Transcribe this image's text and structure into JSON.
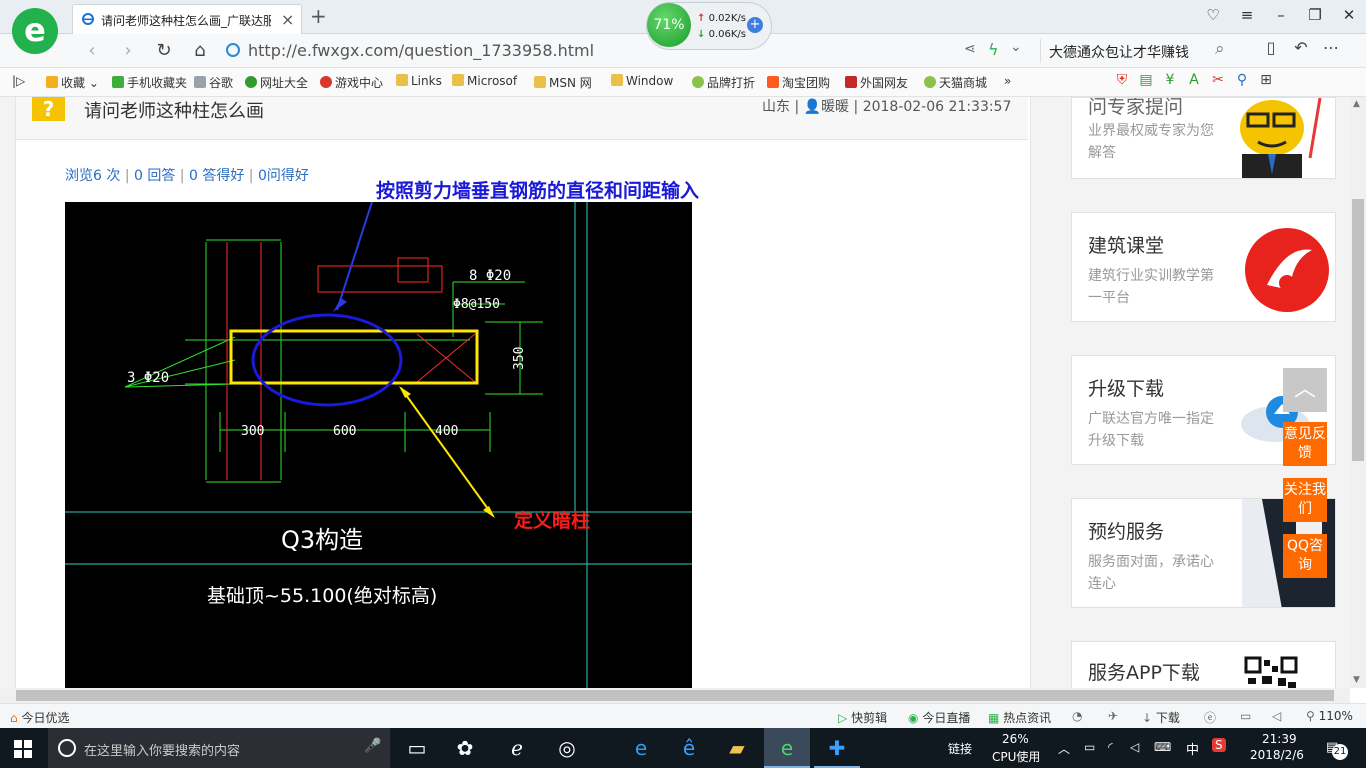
{
  "browser": {
    "tab_title": "请问老师这种柱怎么画_广联达服",
    "url": "http://e.fwxgx.com/question_1733958.html",
    "search_text": "大德通众包让才华赚钱",
    "speed": {
      "percent": "71%",
      "up": "0.02K/s",
      "down": "0.06K/s"
    }
  },
  "bookmarks": [
    {
      "label": "收藏",
      "color": "#f2b01e"
    },
    {
      "label": "手机收藏夹",
      "color": "#3dae3d"
    },
    {
      "label": "谷歌",
      "color": "#9aa3ab"
    },
    {
      "label": "网址大全",
      "color": "#2e9d2e"
    },
    {
      "label": "游戏中心",
      "color": "#d9362b"
    },
    {
      "label": "Links",
      "color": "#e8c04a"
    },
    {
      "label": "Microsof",
      "color": "#e8c04a"
    },
    {
      "label": "MSN 网",
      "color": "#e8c04a"
    },
    {
      "label": "Window",
      "color": "#e8c04a"
    },
    {
      "label": "品牌打折",
      "color": "#8bc34a"
    },
    {
      "label": "淘宝团购",
      "color": "#ff5a1f"
    },
    {
      "label": "外国网友",
      "color": "#c62828"
    },
    {
      "label": "天猫商城",
      "color": "#8bc34a"
    }
  ],
  "question": {
    "title": "请问老师这种柱怎么画",
    "location": "山东",
    "user": "暖暖",
    "time": "2018-02-06 21:33:57",
    "stats": [
      "浏览6 次",
      "0 回答",
      "0 答得好",
      "0问得好"
    ]
  },
  "drawing": {
    "annotation_top": "按照剪力墙垂直钢筋的直径和间距输入",
    "annotation_right": "定义暗柱",
    "rebar_top": "8 Φ20",
    "stirrup": "Φ8@150",
    "rebar_left": "3 Φ20",
    "dim_height": "350",
    "dim_a": "300",
    "dim_b": "600",
    "dim_c": "400",
    "section_name": "Q3构造",
    "elevation": "基础顶~55.100(绝对标高)"
  },
  "sidebar": [
    {
      "title": "问专家提问",
      "desc": "业界最权威专家为您解答"
    },
    {
      "title": "建筑课堂",
      "desc": "建筑行业实训教学第一平台"
    },
    {
      "title": "升级下载",
      "desc": "广联达官方唯一指定升级下载"
    },
    {
      "title": "预约服务",
      "desc": "服务面对面，承诺心连心"
    },
    {
      "title": "服务APP下载",
      "desc": ""
    }
  ],
  "float_buttons": [
    "意见反馈",
    "关注我们",
    "QQ咨询"
  ],
  "statusbar": {
    "left": "今日优选",
    "items": [
      "快剪辑",
      "今日直播",
      "热点资讯",
      "下载"
    ],
    "zoom": "110%"
  },
  "taskbar": {
    "search_placeholder": "在这里输入你要搜索的内容",
    "links_label": "链接",
    "cpu_percent": "26%",
    "cpu_label": "CPU使用",
    "ime": "中",
    "time": "21:39",
    "date": "2018/2/6",
    "notifications": "21"
  }
}
